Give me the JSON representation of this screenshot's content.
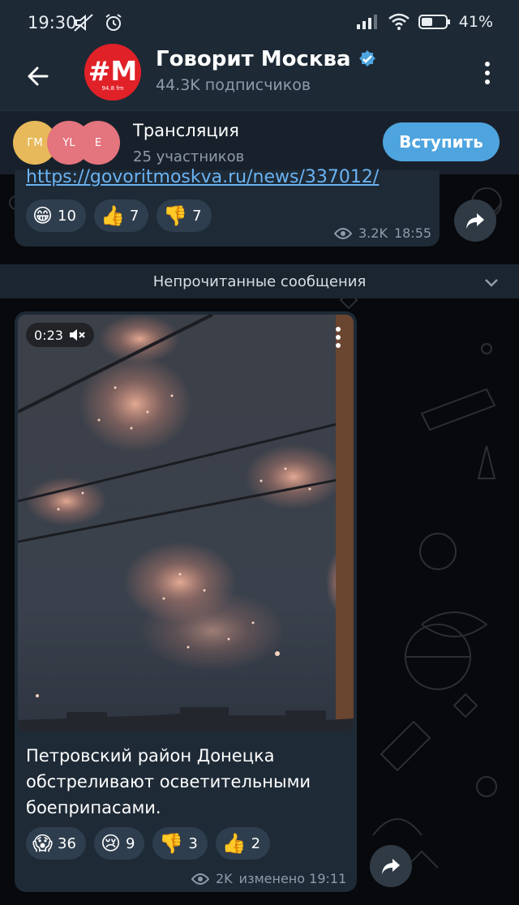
{
  "status_bar": {
    "time": "19:30",
    "battery": "41%",
    "icons": [
      "mute-icon",
      "alarm-icon",
      "signal-icon",
      "wifi-icon",
      "battery-icon"
    ]
  },
  "header": {
    "channel_name": "Говорит Москва",
    "subscribers": "44.3K подписчиков",
    "avatar_logo": "#M",
    "avatar_freq": "94.8 fm",
    "verified": true
  },
  "live": {
    "avatars": [
      {
        "initials": "ГМ",
        "color": "#e8b95a"
      },
      {
        "initials": "YL",
        "color": "#e4747d"
      },
      {
        "initials": "E",
        "color": "#e4747d"
      }
    ],
    "title": "Трансляция",
    "participants": "25 участников",
    "join_label": "Вступить"
  },
  "prev_message": {
    "link": "https://govoritmoskva.ru/news/337012/",
    "reactions": [
      {
        "emoji": "😁",
        "count": "10"
      },
      {
        "emoji": "👍",
        "count": "7"
      },
      {
        "emoji": "👎",
        "count": "7"
      }
    ],
    "views": "3.2K",
    "time": "18:55"
  },
  "unread_label": "Непрочитанные сообщения",
  "message": {
    "video_duration": "0:23",
    "text": "Петровский район Донецка обстреливают осветительными боеприпасами.",
    "reactions": [
      {
        "emoji": "😱",
        "count": "36"
      },
      {
        "emoji": "😢",
        "count": "9"
      },
      {
        "emoji": "👎",
        "count": "3"
      },
      {
        "emoji": "👍",
        "count": "2"
      }
    ],
    "views": "2K",
    "edited": "изменено 19:11"
  },
  "colors": {
    "accent": "#4ea4de",
    "bubble": "#1e2a36",
    "header": "#1d2935",
    "brand_red": "#e02127"
  }
}
